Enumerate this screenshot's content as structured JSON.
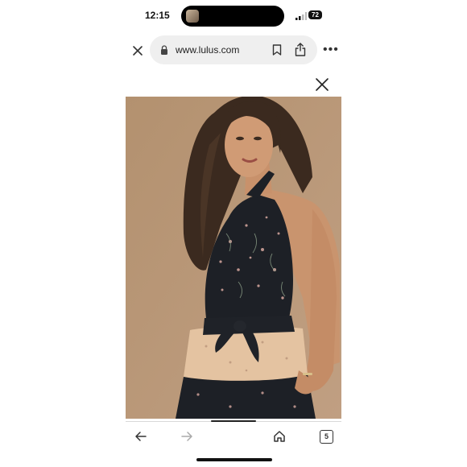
{
  "status_bar": {
    "time": "12:15",
    "battery": "72"
  },
  "browser": {
    "url": "www.lulus.com",
    "more_label": "•••"
  },
  "toolbar": {
    "tab_count": "5"
  },
  "colors": {
    "photo_background": "#b79678",
    "dress": "#1d2026",
    "dress_panel": "#e4c3a1"
  },
  "icons": [
    "close-icon",
    "lock-icon",
    "bookmark-icon",
    "share-icon",
    "more-icon",
    "back-arrow-icon",
    "forward-arrow-icon",
    "home-icon",
    "tabs-icon"
  ]
}
